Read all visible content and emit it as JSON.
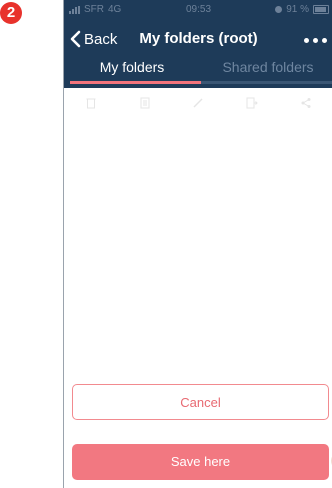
{
  "step_badge": "2",
  "status": {
    "carrier": "SFR",
    "network": "4G",
    "time": "09:53",
    "battery_percent": "91 %"
  },
  "nav": {
    "back_label": "Back",
    "title": "My folders (root)"
  },
  "tabs": [
    {
      "label": "My folders",
      "active": true
    },
    {
      "label": "Shared folders",
      "active": false
    }
  ],
  "toolbar": {
    "icons": [
      "trash-icon",
      "document-icon",
      "pencil-icon",
      "move-icon",
      "share-icon"
    ]
  },
  "buttons": {
    "cancel_label": "Cancel",
    "save_label": "Save here"
  },
  "colors": {
    "header_bg": "#1e3b59",
    "accent": "#f2737b",
    "badge": "#e8322c"
  }
}
